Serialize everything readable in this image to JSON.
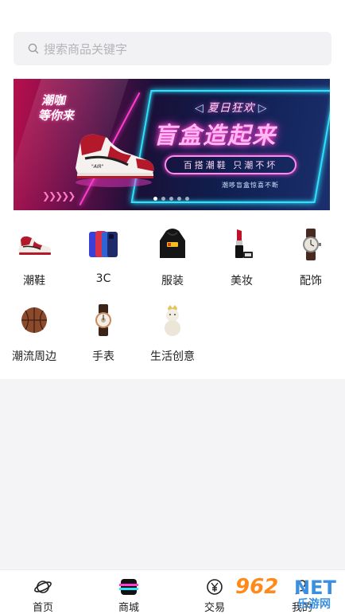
{
  "search": {
    "placeholder": "搜索商品关键字"
  },
  "banner": {
    "tag_line1": "潮咖",
    "tag_line2": "等你来",
    "sub_title": "夏日狂欢",
    "main_title": "盲盒造起来",
    "pill_text": "百搭潮鞋 只潮不坏",
    "small_text": "潮哆盲盒惊喜不断",
    "shoe_text": "\"AIR\"",
    "page_count": 5,
    "active_page": 1
  },
  "categories": [
    {
      "label": "潮鞋",
      "icon": "sneaker-icon"
    },
    {
      "label": "3C",
      "icon": "phone-icon"
    },
    {
      "label": "服装",
      "icon": "hoodie-icon"
    },
    {
      "label": "美妆",
      "icon": "lipstick-icon"
    },
    {
      "label": "配饰",
      "icon": "watch-icon"
    },
    {
      "label": "潮流周边",
      "icon": "basketball-icon"
    },
    {
      "label": "手表",
      "icon": "wristwatch-icon"
    },
    {
      "label": "生活创意",
      "icon": "figurine-icon"
    }
  ],
  "tabbar": {
    "items": [
      {
        "label": "首页",
        "icon": "home-planet-icon"
      },
      {
        "label": "商城",
        "icon": "mall-icon",
        "active": true
      },
      {
        "label": "交易",
        "icon": "yuan-exchange-icon"
      },
      {
        "label": "我的",
        "icon": "profile-icon"
      }
    ]
  },
  "watermark": {
    "logo_text": "962",
    "logo_suffix": "NET",
    "site_name": "乐游网"
  },
  "colors": {
    "accent_pink": "#ff3ccf",
    "accent_cyan": "#2fe3ff",
    "background": "#f4f4f6"
  }
}
